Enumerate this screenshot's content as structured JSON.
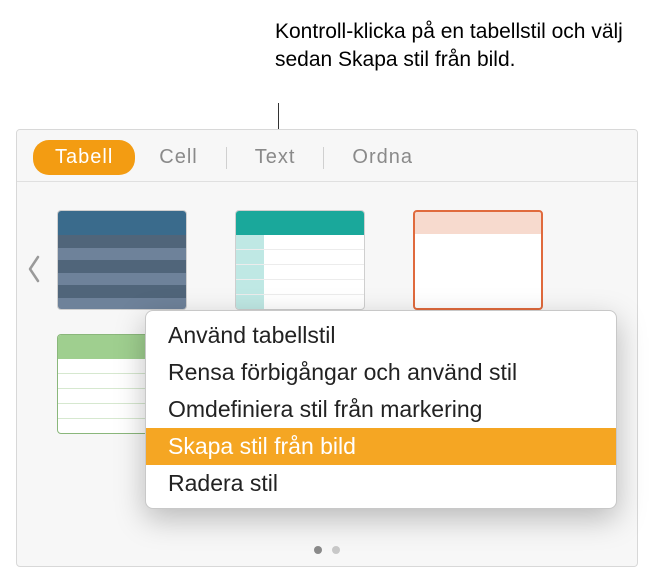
{
  "callout": "Kontroll-klicka på en tabellstil och välj sedan Skapa stil från bild.",
  "tabs": {
    "items": [
      "Tabell",
      "Cell",
      "Text",
      "Ordna"
    ],
    "active_index": 0
  },
  "context_menu": {
    "items": [
      "Använd tabellstil",
      "Rensa förbigångar och använd stil",
      "Omdefiniera stil från markering",
      "Skapa stil från bild",
      "Radera stil"
    ],
    "highlighted_index": 3
  },
  "pager": {
    "count": 2,
    "active": 0
  }
}
